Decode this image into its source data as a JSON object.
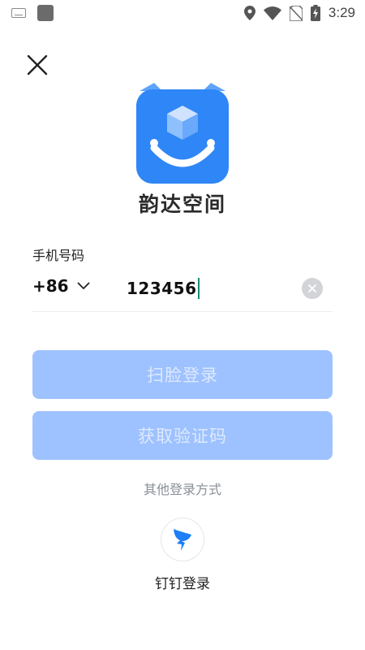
{
  "status_bar": {
    "time": "3:29",
    "left_icons": [
      "keyboard-icon",
      "notification-square-icon"
    ],
    "right_icons": [
      "location-icon",
      "wifi-icon",
      "no-sim-icon",
      "battery-charging-icon"
    ]
  },
  "close_icon": "close-icon",
  "app": {
    "name": "韵达空间",
    "logo_color": "#2f86f6"
  },
  "phone": {
    "label": "手机号码",
    "country_code": "+86",
    "value": "123456",
    "clear_icon": "clear-icon"
  },
  "buttons": {
    "face_login": "扫脸登录",
    "get_code": "获取验证码",
    "disabled_color": "#9ec2ff"
  },
  "other_login": {
    "label": "其他登录方式",
    "dingtalk_label": "钉钉登录",
    "dingtalk_icon": "dingtalk-icon"
  }
}
